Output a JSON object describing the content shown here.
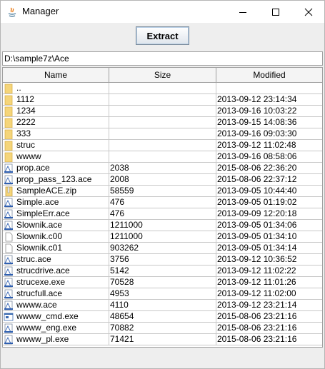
{
  "window": {
    "title": "Manager",
    "minimize_icon": "minimize-icon",
    "maximize_icon": "maximize-icon",
    "close_icon": "close-icon"
  },
  "toolbar": {
    "extract_label": "Extract"
  },
  "path": {
    "value": "D:\\sample7z\\Ace"
  },
  "table": {
    "headers": {
      "name": "Name",
      "size": "Size",
      "modified": "Modified"
    },
    "rows": [
      {
        "icon": "folder-icon",
        "name": "..",
        "size": "",
        "modified": ""
      },
      {
        "icon": "folder-icon",
        "name": "1112",
        "size": "",
        "modified": "2013-09-12 23:14:34"
      },
      {
        "icon": "folder-icon",
        "name": "1234",
        "size": "",
        "modified": "2013-09-16 10:03:22"
      },
      {
        "icon": "folder-icon",
        "name": "2222",
        "size": "",
        "modified": "2013-09-15 14:08:36"
      },
      {
        "icon": "folder-icon",
        "name": "333",
        "size": "",
        "modified": "2013-09-16 09:03:30"
      },
      {
        "icon": "folder-icon",
        "name": "struc",
        "size": "",
        "modified": "2013-09-12 11:02:48"
      },
      {
        "icon": "folder-icon",
        "name": "wwww",
        "size": "",
        "modified": "2013-09-16 08:58:06"
      },
      {
        "icon": "archive-icon",
        "name": "prop.ace",
        "size": "2038",
        "modified": "2015-08-06 22:36:20"
      },
      {
        "icon": "archive-icon",
        "name": "prop_pass_123.ace",
        "size": "2008",
        "modified": "2015-08-06 22:37:12"
      },
      {
        "icon": "zip-icon",
        "name": "SampleACE.zip",
        "size": "58559",
        "modified": "2013-09-05 10:44:40"
      },
      {
        "icon": "archive-icon",
        "name": "Simple.ace",
        "size": "476",
        "modified": "2013-09-05 01:19:02"
      },
      {
        "icon": "archive-icon",
        "name": "SimpleErr.ace",
        "size": "476",
        "modified": "2013-09-09 12:20:18"
      },
      {
        "icon": "archive-icon",
        "name": "Slownik.ace",
        "size": "1211000",
        "modified": "2013-09-05 01:34:06"
      },
      {
        "icon": "file-icon",
        "name": "Slownik.c00",
        "size": "1211000",
        "modified": "2013-09-05 01:34:10"
      },
      {
        "icon": "file-icon",
        "name": "Slownik.c01",
        "size": "903262",
        "modified": "2013-09-05 01:34:14"
      },
      {
        "icon": "archive-icon",
        "name": "struc.ace",
        "size": "3756",
        "modified": "2013-09-12 10:36:52"
      },
      {
        "icon": "archive-icon",
        "name": "strucdrive.ace",
        "size": "5142",
        "modified": "2013-09-12 11:02:22"
      },
      {
        "icon": "archive-icon",
        "name": "strucexe.exe",
        "size": "70528",
        "modified": "2013-09-12 11:01:26"
      },
      {
        "icon": "archive-icon",
        "name": "strucfull.ace",
        "size": "4953",
        "modified": "2013-09-12 11:02:00"
      },
      {
        "icon": "archive-icon",
        "name": "wwww.ace",
        "size": "4110",
        "modified": "2013-09-12 23:21:14"
      },
      {
        "icon": "exe-icon",
        "name": "wwww_cmd.exe",
        "size": "48654",
        "modified": "2015-08-06 23:21:16"
      },
      {
        "icon": "archive-icon",
        "name": "wwww_eng.exe",
        "size": "70882",
        "modified": "2015-08-06 23:21:16"
      },
      {
        "icon": "archive-icon",
        "name": "wwww_pl.exe",
        "size": "71421",
        "modified": "2015-08-06 23:21:16"
      }
    ]
  }
}
